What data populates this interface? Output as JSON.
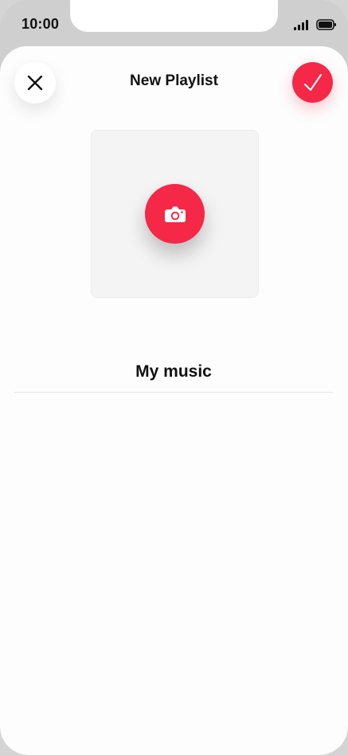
{
  "status_bar": {
    "time": "10:00"
  },
  "header": {
    "title": "New Playlist"
  },
  "artwork": {
    "icon": "camera-icon"
  },
  "playlist": {
    "name_value": "My music"
  },
  "actions": {
    "close_icon": "close-icon",
    "confirm_icon": "checkmark-icon"
  },
  "colors": {
    "accent": "#f52848"
  }
}
